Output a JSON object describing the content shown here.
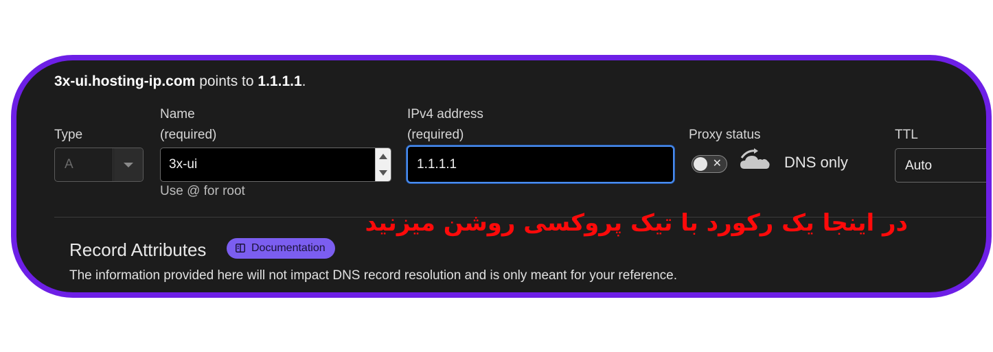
{
  "header": {
    "hostname": "3x-ui.hosting-ip.com",
    "points_to_text": "points to",
    "ip": "1.1.1.1",
    "period": "."
  },
  "form": {
    "type": {
      "label": "Type",
      "value": "A"
    },
    "name": {
      "label": "Name",
      "required": "(required)",
      "value": "3x-ui",
      "hint": "Use @ for root"
    },
    "ipv4": {
      "label": "IPv4 address",
      "required": "(required)",
      "value": "1.1.1.1"
    },
    "proxy": {
      "label": "Proxy status",
      "state_text": "DNS only",
      "enabled": false,
      "toggle_icon": "x-icon",
      "cloud_icon": "cloud-dns-only-icon"
    },
    "ttl": {
      "label": "TTL",
      "value": "Auto"
    }
  },
  "annotation": {
    "text": "در اینجا یک رکورد با تیک پروکسی روشن میزنید",
    "color": "#ff0a0a"
  },
  "record_attributes": {
    "title": "Record Attributes",
    "doc_badge": "Documentation",
    "description": "The information provided here will not impact DNS record resolution and is only meant for your reference."
  },
  "colors": {
    "frame": "#6d1fe6",
    "panel_bg": "#1c1c1c",
    "focus_border": "#4a8df0",
    "badge": "#7b5ef0"
  }
}
